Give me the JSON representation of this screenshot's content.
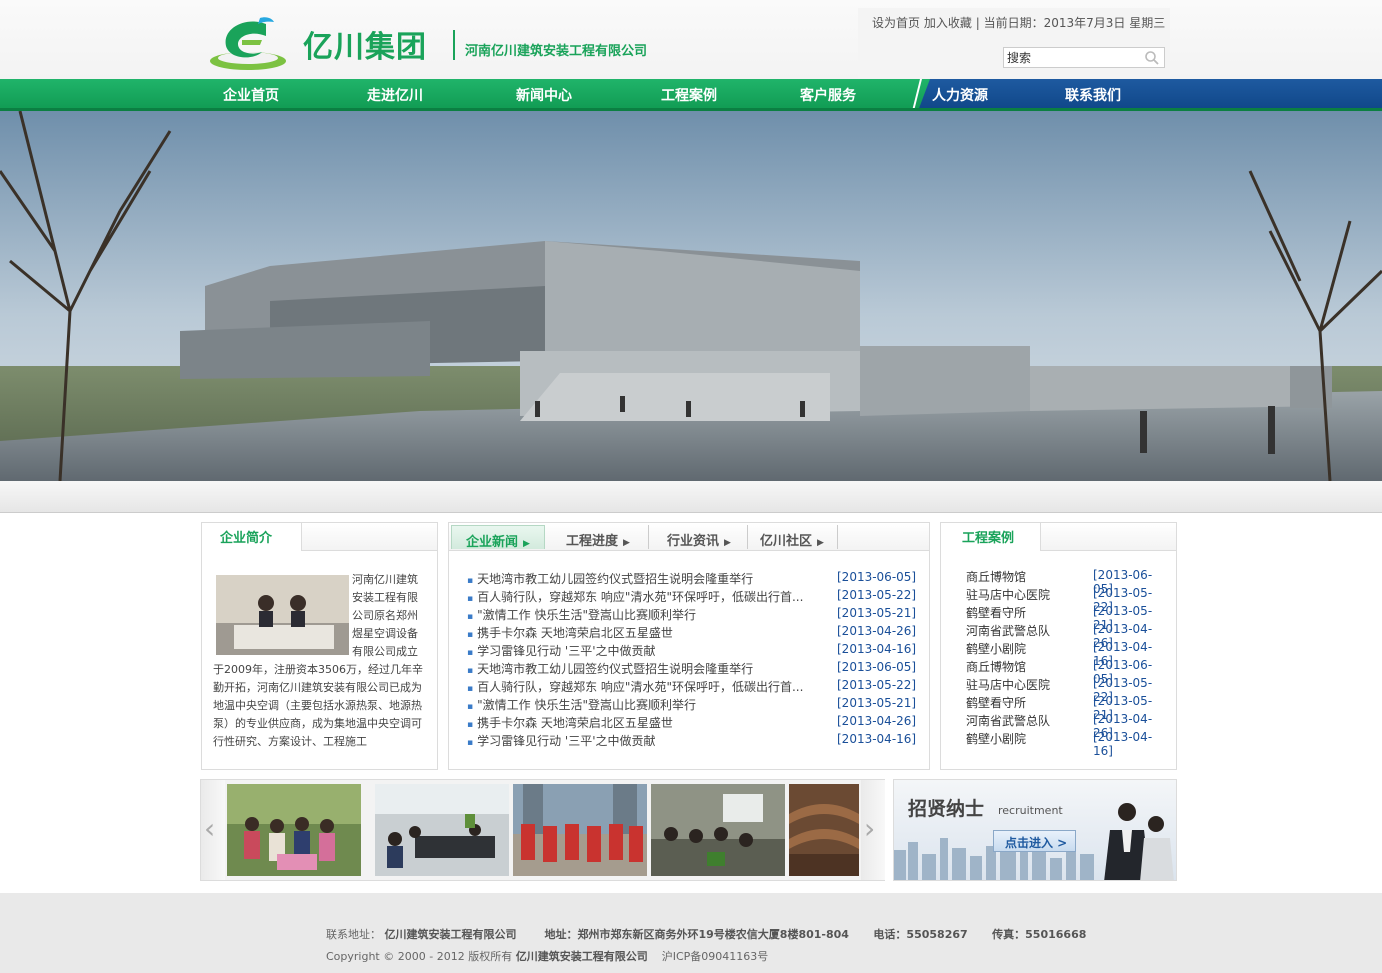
{
  "header": {
    "logo_name": "亿川集团",
    "logo_subtitle": "河南亿川建筑安装工程有限公司",
    "set_home": "设为首页",
    "add_favorite": "加入收藏",
    "separator": "|",
    "date_label": "当前日期：2013年7月3日",
    "weekday": "星期三",
    "search_value": "搜索"
  },
  "nav": {
    "items": [
      "企业首页",
      "走进亿川",
      "新闻中心",
      "工程案例",
      "客户服务",
      "人力资源",
      "联系我们"
    ]
  },
  "about": {
    "title": "企业简介",
    "text": "河南亿川建筑安装工程有限公司原名郑州煜星空调设备有限公司成立于2009年，注册资本3506万，经过几年辛勤开拓，河南亿川建筑安装有限公司已成为地温中央空调（主要包括水源热泵、地源热泵）的专业供应商，成为集地温中央空调可行性研究、方案设计、工程施工"
  },
  "news": {
    "tabs": [
      "企业新闻",
      "工程进度",
      "行业资讯",
      "亿川社区"
    ],
    "items": [
      {
        "title": "天地湾市教工幼儿园签约仪式暨招生说明会隆重举行",
        "date": "[2013-06-05]"
      },
      {
        "title": "百人骑行队，穿越郑东 响应\"清水苑\"环保呼吁，低碳出行首...",
        "date": "[2013-05-22]"
      },
      {
        "title": "\"激情工作 快乐生活\"登嵩山比赛顺利举行",
        "date": "[2013-05-21]"
      },
      {
        "title": "携手卡尔森 天地湾荣启北区五星盛世",
        "date": "[2013-04-26]"
      },
      {
        "title": "学习雷锋见行动 '三平'之中做贡献",
        "date": "[2013-04-16]"
      },
      {
        "title": "天地湾市教工幼儿园签约仪式暨招生说明会隆重举行",
        "date": "[2013-06-05]"
      },
      {
        "title": "百人骑行队，穿越郑东 响应\"清水苑\"环保呼吁，低碳出行首...",
        "date": "[2013-05-22]"
      },
      {
        "title": "\"激情工作 快乐生活\"登嵩山比赛顺利举行",
        "date": "[2013-05-21]"
      },
      {
        "title": "携手卡尔森 天地湾荣启北区五星盛世",
        "date": "[2013-04-26]"
      },
      {
        "title": "学习雷锋见行动 '三平'之中做贡献",
        "date": "[2013-04-16]"
      }
    ]
  },
  "cases": {
    "title": "工程案例",
    "items": [
      {
        "name": "商丘博物馆",
        "date": "[2013-06-05]"
      },
      {
        "name": "驻马店中心医院",
        "date": "[2013-05-22]"
      },
      {
        "name": "鹤壁看守所",
        "date": "[2013-05-21]"
      },
      {
        "name": "河南省武警总队",
        "date": "[2013-04-26]"
      },
      {
        "name": "鹤壁小剧院",
        "date": "[2013-04-16]"
      },
      {
        "name": "商丘博物馆",
        "date": "[2013-06-05]"
      },
      {
        "name": "驻马店中心医院",
        "date": "[2013-05-22]"
      },
      {
        "name": "鹤壁看守所",
        "date": "[2013-05-21]"
      },
      {
        "name": "河南省武警总队",
        "date": "[2013-04-26]"
      },
      {
        "name": "鹤壁小剧院",
        "date": "[2013-04-16]"
      }
    ]
  },
  "gallery": {
    "prev": "‹",
    "next": "›"
  },
  "recruit": {
    "title": "招贤纳士",
    "subtitle": "recruitment",
    "button": "点击进入 >"
  },
  "footer": {
    "address_label": "联系地址：",
    "company": "亿川建筑安装工程有限公司",
    "address": "地址：郑州市郑东新区商务外环19号楼农信大厦8楼801-804",
    "phone": "电话：55058267",
    "fax": "传真：55016668",
    "copyright": "Copyright © 2000 - 2012 版权所有",
    "company2": "亿川建筑安装工程有限公司",
    "icp": "沪ICP备09041163号"
  },
  "colors": {
    "brand_green": "#1aa35a",
    "nav_blue": "#1e5aa0",
    "date_blue": "#1a4f99"
  }
}
